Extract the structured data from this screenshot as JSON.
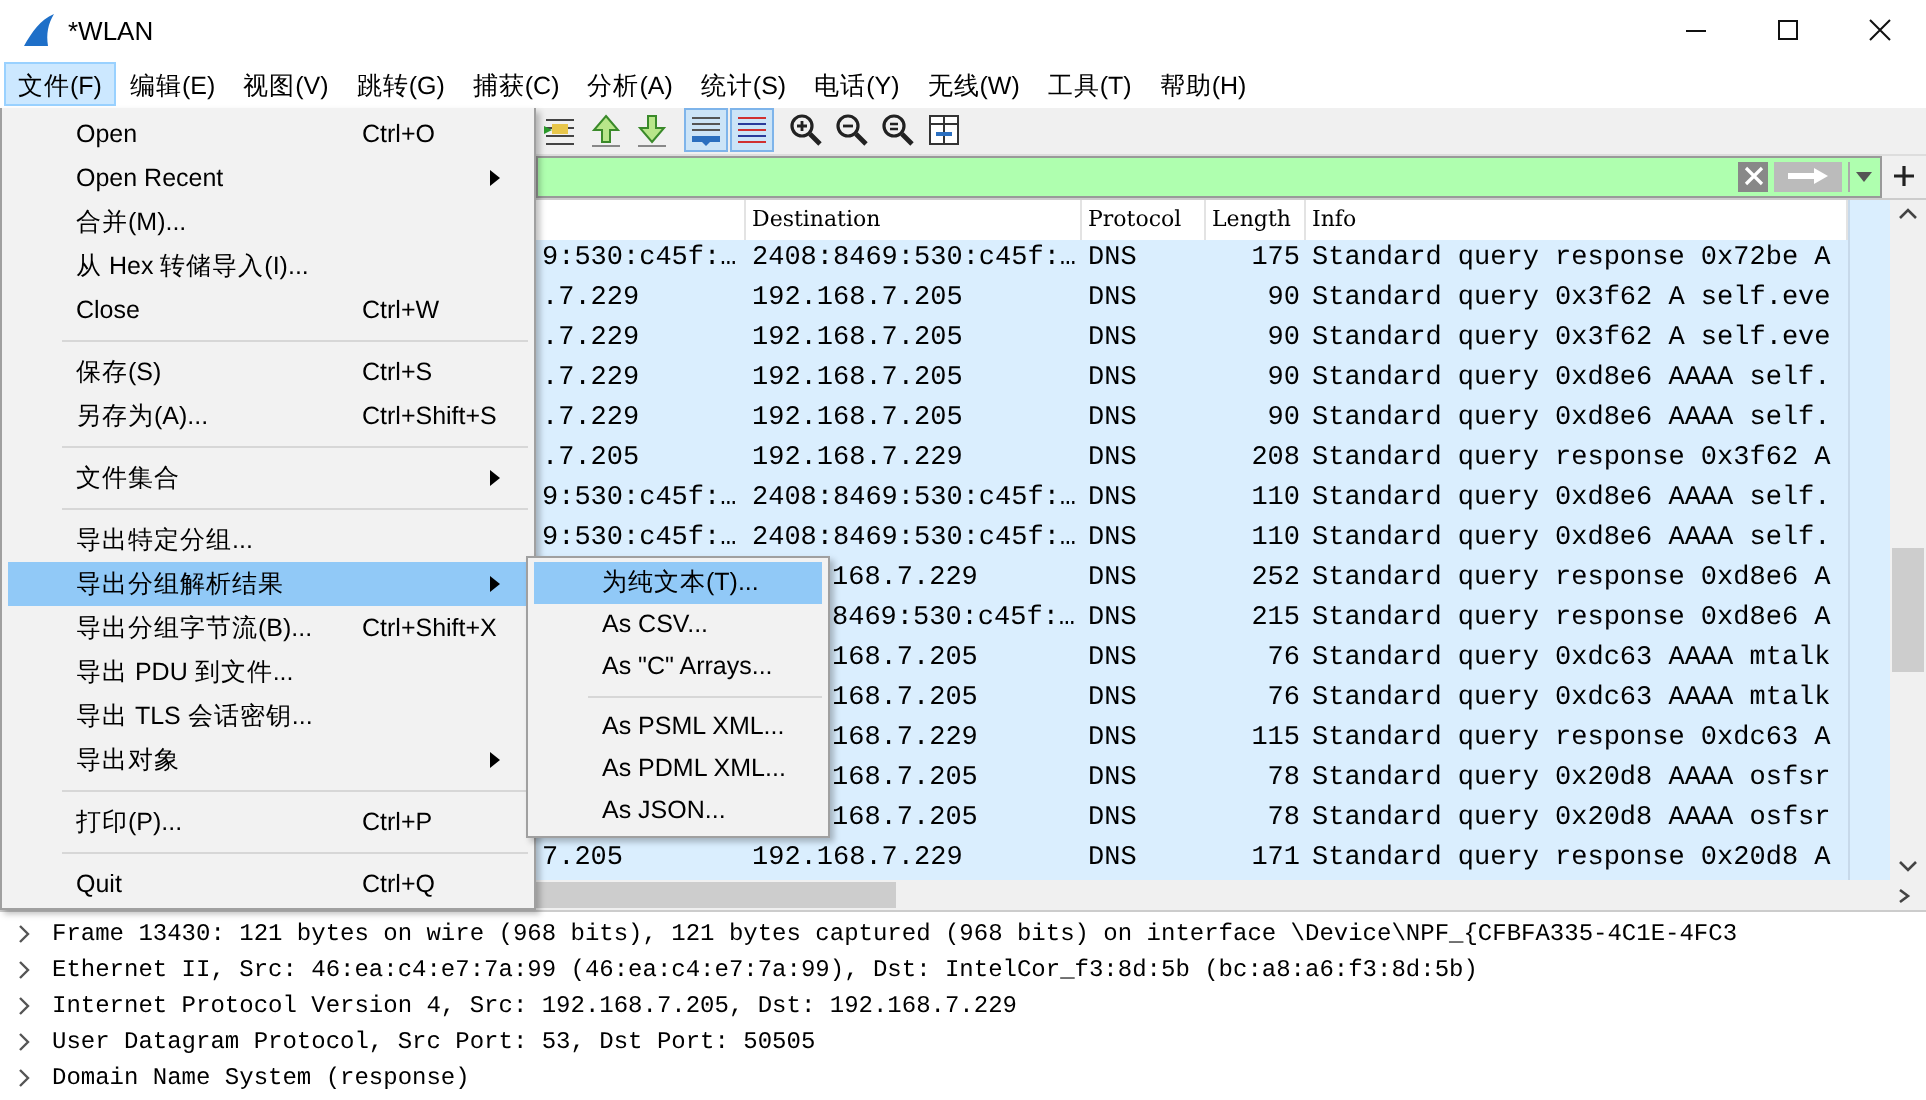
{
  "window": {
    "title": "*WLAN"
  },
  "menubar": [
    {
      "label": "文件(F)",
      "selected": true
    },
    {
      "label": "编辑(E)",
      "selected": false
    },
    {
      "label": "视图(V)",
      "selected": false
    },
    {
      "label": "跳转(G)",
      "selected": false
    },
    {
      "label": "捕获(C)",
      "selected": false
    },
    {
      "label": "分析(A)",
      "selected": false
    },
    {
      "label": "统计(S)",
      "selected": false
    },
    {
      "label": "电话(Y)",
      "selected": false
    },
    {
      "label": "无线(W)",
      "selected": false
    },
    {
      "label": "工具(T)",
      "selected": false
    },
    {
      "label": "帮助(H)",
      "selected": false
    }
  ],
  "file_menu": [
    {
      "kind": "item",
      "label": "Open",
      "shortcut": "Ctrl+O",
      "submenu": false,
      "selected": false
    },
    {
      "kind": "item",
      "label": "Open Recent",
      "submenu": true,
      "selected": false
    },
    {
      "kind": "item",
      "label": "合并(M)...",
      "submenu": false,
      "selected": false
    },
    {
      "kind": "item",
      "label": "从 Hex 转储导入(I)...",
      "submenu": false,
      "selected": false
    },
    {
      "kind": "item",
      "label": "Close",
      "shortcut": "Ctrl+W",
      "submenu": false,
      "selected": false
    },
    {
      "kind": "separator"
    },
    {
      "kind": "item",
      "label": "保存(S)",
      "shortcut": "Ctrl+S",
      "submenu": false,
      "selected": false
    },
    {
      "kind": "item",
      "label": "另存为(A)...",
      "shortcut": "Ctrl+Shift+S",
      "submenu": false,
      "selected": false
    },
    {
      "kind": "separator"
    },
    {
      "kind": "item",
      "label": "文件集合",
      "submenu": true,
      "selected": false
    },
    {
      "kind": "separator"
    },
    {
      "kind": "item",
      "label": "导出特定分组...",
      "submenu": false,
      "selected": false
    },
    {
      "kind": "item",
      "label": "导出分组解析结果",
      "submenu": true,
      "selected": true
    },
    {
      "kind": "item",
      "label": "导出分组字节流(B)...",
      "shortcut": "Ctrl+Shift+X",
      "submenu": false,
      "selected": false
    },
    {
      "kind": "item",
      "label": "导出 PDU 到文件...",
      "submenu": false,
      "selected": false
    },
    {
      "kind": "item",
      "label": "导出 TLS 会话密钥...",
      "submenu": false,
      "selected": false
    },
    {
      "kind": "item",
      "label": "导出对象",
      "submenu": true,
      "selected": false
    },
    {
      "kind": "separator"
    },
    {
      "kind": "item",
      "label": "打印(P)...",
      "shortcut": "Ctrl+P",
      "submenu": false,
      "selected": false
    },
    {
      "kind": "separator"
    },
    {
      "kind": "item",
      "label": "Quit",
      "shortcut": "Ctrl+Q",
      "submenu": false,
      "selected": false
    }
  ],
  "export_submenu": [
    {
      "kind": "item",
      "label": "为纯文本(T)...",
      "selected": true
    },
    {
      "kind": "item",
      "label": "As CSV...",
      "selected": false
    },
    {
      "kind": "item",
      "label": "As \"C\" Arrays...",
      "selected": false
    },
    {
      "kind": "separator"
    },
    {
      "kind": "item",
      "label": "As PSML XML...",
      "selected": false
    },
    {
      "kind": "item",
      "label": "As PDML XML...",
      "selected": false
    },
    {
      "kind": "item",
      "label": "As JSON...",
      "selected": false
    }
  ],
  "toolbar": [
    {
      "kind": "list-go",
      "pressed": false
    },
    {
      "kind": "up",
      "pressed": false
    },
    {
      "kind": "down",
      "pressed": false
    },
    {
      "kind": "autoscroll",
      "pressed": true
    },
    {
      "kind": "colorize",
      "pressed": true
    },
    {
      "kind": "zoom-in",
      "pressed": false
    },
    {
      "kind": "zoom-out",
      "pressed": false
    },
    {
      "kind": "zoom-reset",
      "pressed": false
    },
    {
      "kind": "resize",
      "pressed": false
    }
  ],
  "filter": {
    "valid": true
  },
  "packet_list": {
    "columns": [
      "Destination",
      "Protocol",
      "Length",
      "Info"
    ],
    "rows": [
      {
        "source": "9:530:c45f:…",
        "destination": "2408:8469:530:c45f:…",
        "protocol": "DNS",
        "length": "175",
        "info": "Standard query response 0x72be A",
        "color": "#daeefe"
      },
      {
        "source": ".7.229",
        "destination": "192.168.7.205",
        "protocol": "DNS",
        "length": "90",
        "info": "Standard query 0x3f62 A self.eve",
        "color": "#daeefe"
      },
      {
        "source": ".7.229",
        "destination": "192.168.7.205",
        "protocol": "DNS",
        "length": "90",
        "info": "Standard query 0x3f62 A self.eve",
        "color": "#daeefe"
      },
      {
        "source": ".7.229",
        "destination": "192.168.7.205",
        "protocol": "DNS",
        "length": "90",
        "info": "Standard query 0xd8e6 AAAA self.",
        "color": "#daeefe"
      },
      {
        "source": ".7.229",
        "destination": "192.168.7.205",
        "protocol": "DNS",
        "length": "90",
        "info": "Standard query 0xd8e6 AAAA self.",
        "color": "#daeefe"
      },
      {
        "source": ".7.205",
        "destination": "192.168.7.229",
        "protocol": "DNS",
        "length": "208",
        "info": "Standard query response 0x3f62 A",
        "color": "#daeefe"
      },
      {
        "source": "9:530:c45f:…",
        "destination": "2408:8469:530:c45f:…",
        "protocol": "DNS",
        "length": "110",
        "info": "Standard query 0xd8e6 AAAA self.",
        "color": "#daeefe"
      },
      {
        "source": "9:530:c45f:…",
        "destination": "2408:8469:530:c45f:…",
        "protocol": "DNS",
        "length": "110",
        "info": "Standard query 0xd8e6 AAAA self.",
        "color": "#daeefe"
      },
      {
        "destination": "168.7.229",
        "protocol": "DNS",
        "length": "252",
        "info": "Standard query response 0xd8e6 A",
        "color": "#daeefe"
      },
      {
        "destination": "8469:530:c45f:…",
        "protocol": "DNS",
        "length": "215",
        "info": "Standard query response 0xd8e6 A",
        "color": "#daeefe"
      },
      {
        "destination": "168.7.205",
        "protocol": "DNS",
        "length": "76",
        "info": "Standard query 0xdc63 AAAA mtalk",
        "color": "#daeefe"
      },
      {
        "destination": "168.7.205",
        "protocol": "DNS",
        "length": "76",
        "info": "Standard query 0xdc63 AAAA mtalk",
        "color": "#daeefe"
      },
      {
        "destination": "168.7.229",
        "protocol": "DNS",
        "length": "115",
        "info": "Standard query response 0xdc63 A",
        "color": "#daeefe"
      },
      {
        "destination": "168.7.205",
        "protocol": "DNS",
        "length": "78",
        "info": "Standard query 0x20d8 AAAA osfsr",
        "color": "#daeefe"
      },
      {
        "destination": "168.7.205",
        "protocol": "DNS",
        "length": "78",
        "info": "Standard query 0x20d8 AAAA osfsr",
        "color": "#daeefe"
      },
      {
        "source": "7.205",
        "destination": "192.168.7.229",
        "protocol": "DNS",
        "length": "171",
        "info": "Standard query response 0x20d8 A",
        "color": "#daeefe"
      }
    ]
  },
  "details": [
    {
      "text": "Frame 13430: 121 bytes on wire (968 bits), 121 bytes captured (968 bits) on interface \\Device\\NPF_{CFBFA335-4C1E-4FC3",
      "expanded": false
    },
    {
      "text": "Ethernet II, Src: 46:ea:c4:e7:7a:99 (46:ea:c4:e7:7a:99), Dst: IntelCor_f3:8d:5b (bc:a8:a6:f3:8d:5b)",
      "expanded": false
    },
    {
      "text": "Internet Protocol Version 4, Src: 192.168.7.205, Dst: 192.168.7.229",
      "expanded": false
    },
    {
      "text": "User Datagram Protocol, Src Port: 53, Dst Port: 50505",
      "expanded": false
    },
    {
      "text": "Domain Name System (response)",
      "expanded": false
    }
  ]
}
